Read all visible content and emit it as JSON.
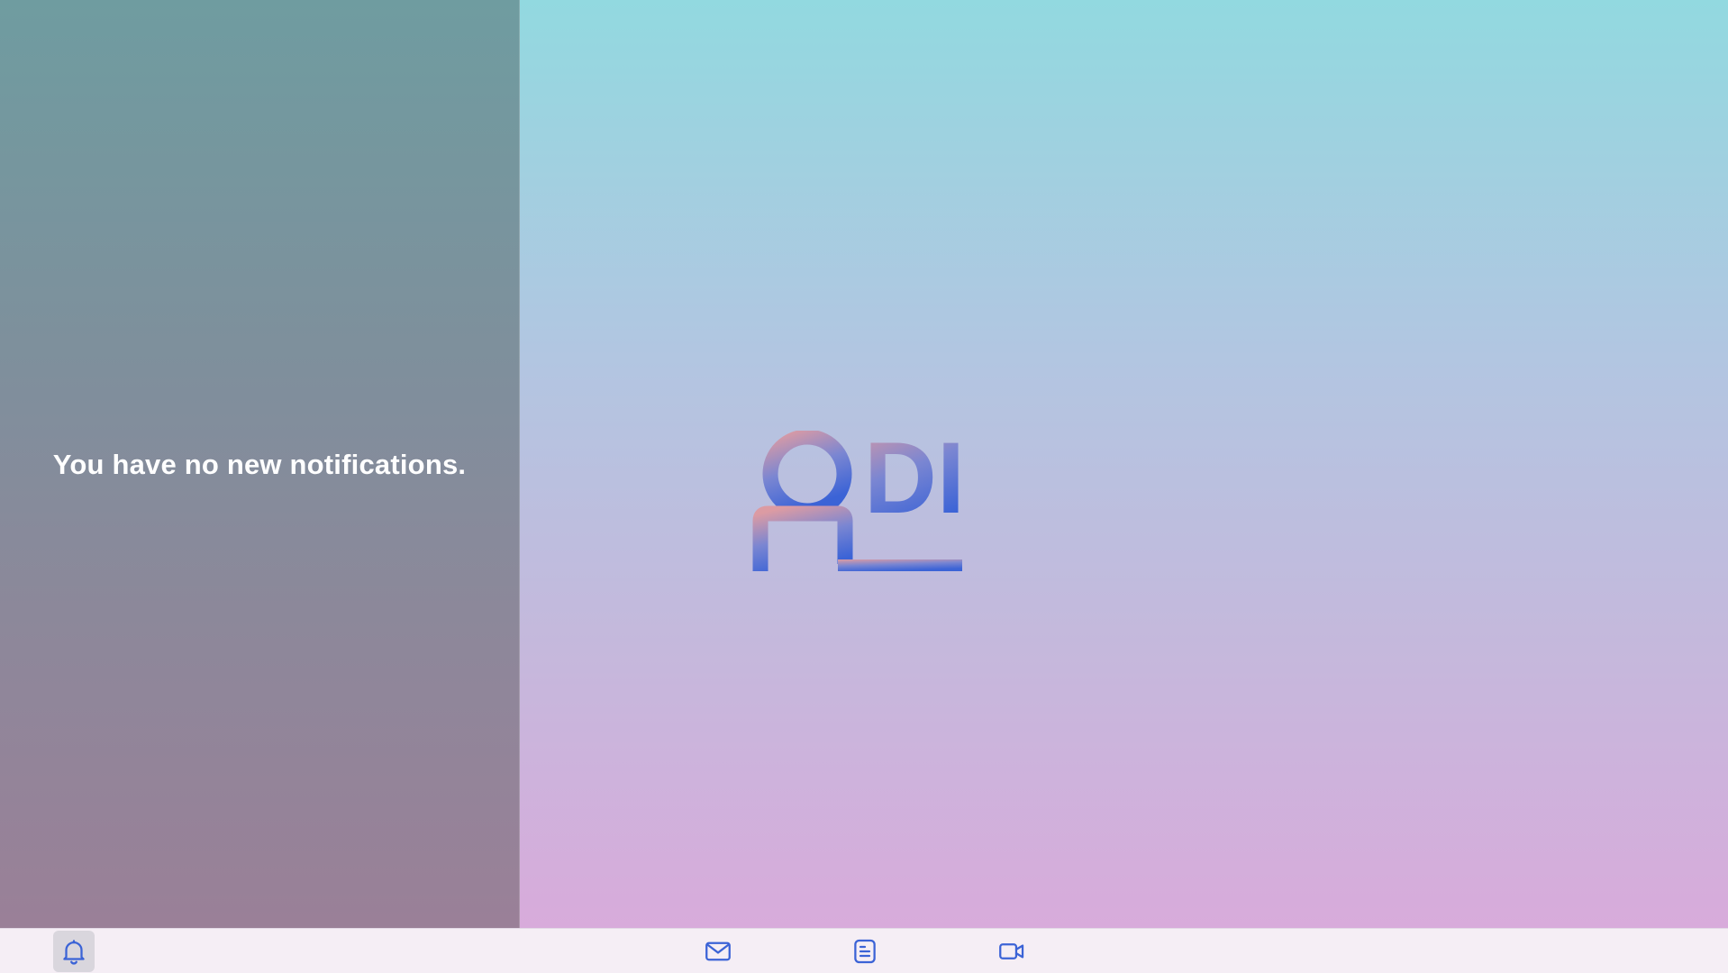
{
  "notifications": {
    "empty_message": "You have no new notifications."
  },
  "desktop": {
    "logo": {
      "text": "DI",
      "name": "di-logo-icon"
    }
  },
  "taskbar": {
    "items": [
      {
        "name": "bell-icon",
        "label": "Notifications",
        "active": true
      },
      {
        "name": "mail-icon",
        "label": "Mail",
        "active": false
      },
      {
        "name": "notes-icon",
        "label": "Notes",
        "active": false
      },
      {
        "name": "video-icon",
        "label": "Video",
        "active": false
      }
    ]
  },
  "colors": {
    "accent": "#3b63d6",
    "logo_gradient_top": "#d89aa8",
    "logo_gradient_bottom": "#3b63d6",
    "taskbar_bg": "#f5eef5"
  }
}
